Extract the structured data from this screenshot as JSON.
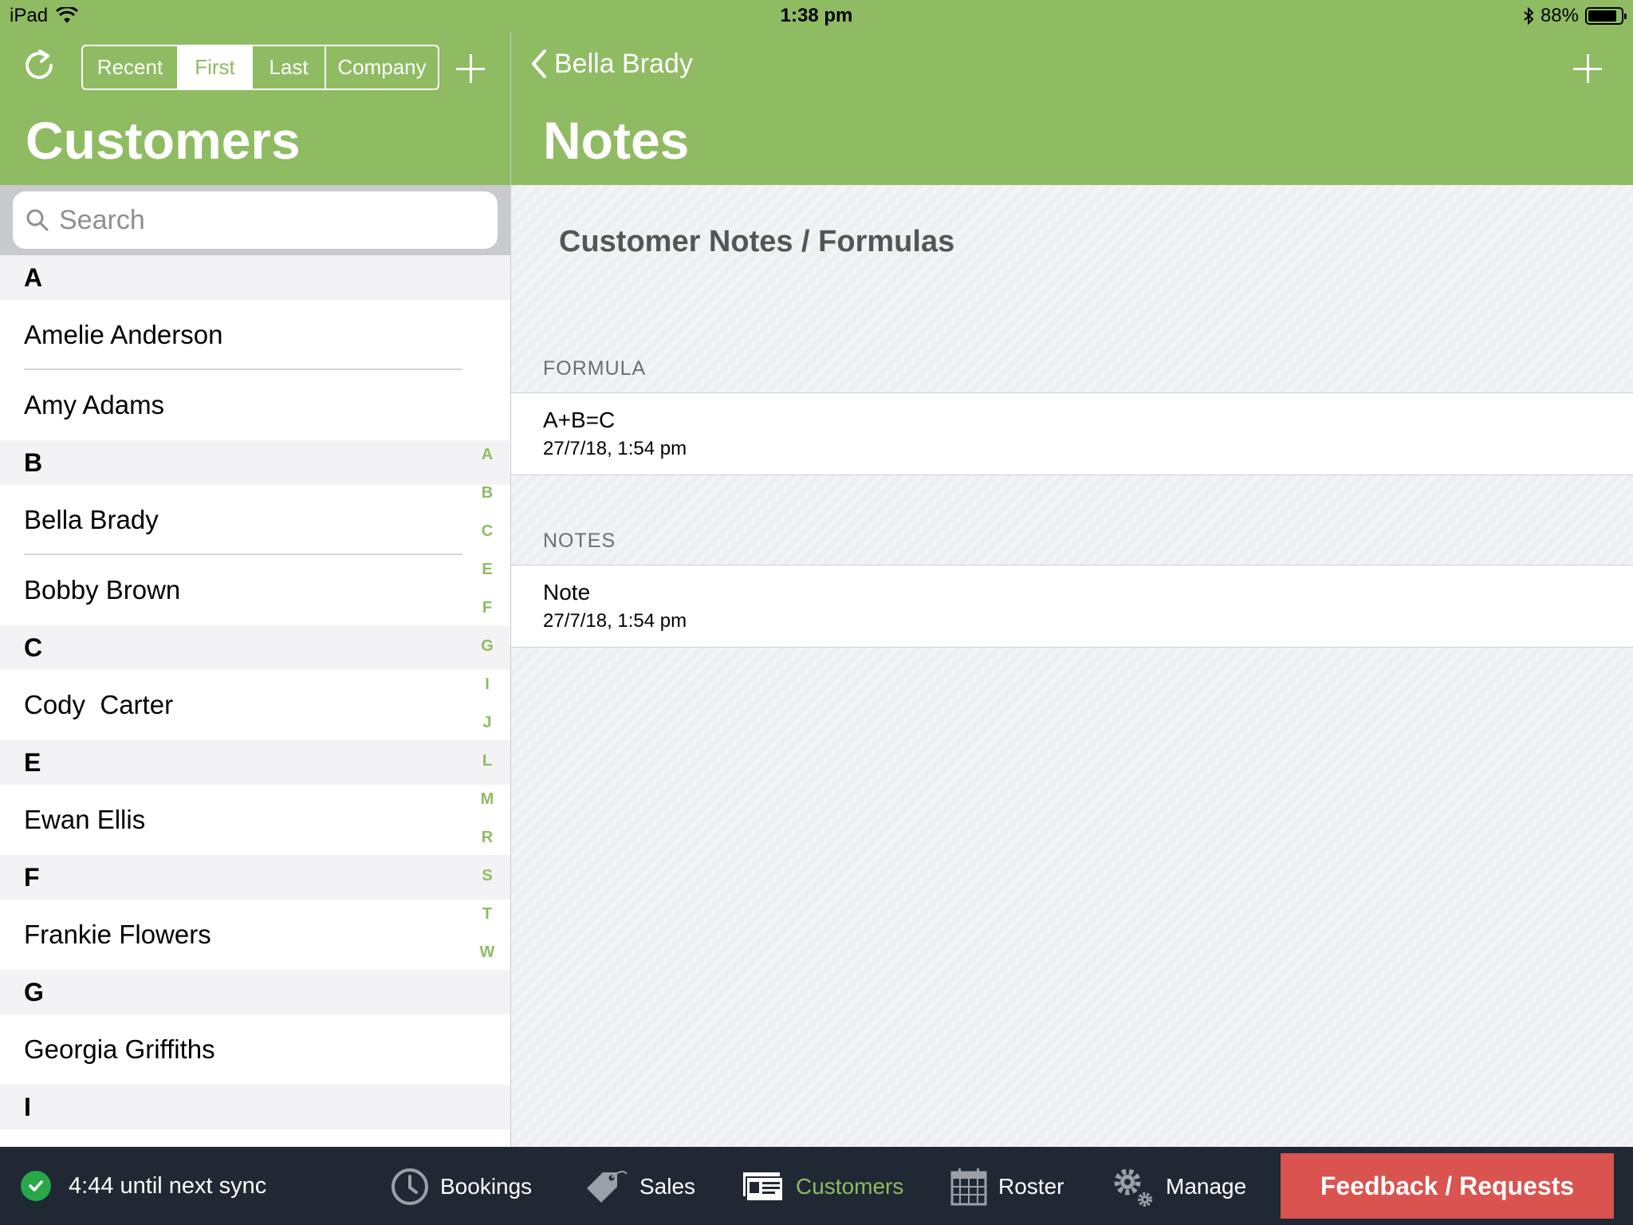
{
  "status_bar": {
    "device": "iPad",
    "time": "1:38 pm",
    "battery": "88%",
    "battery_level": 0.88
  },
  "left_header": {
    "sort_options": [
      {
        "label": "Recent",
        "active": false
      },
      {
        "label": "First",
        "active": true
      },
      {
        "label": "Last",
        "active": false
      },
      {
        "label": "Company",
        "active": false
      }
    ],
    "title": "Customers"
  },
  "search": {
    "placeholder": "Search"
  },
  "customer_list": [
    {
      "letter": "A",
      "names": [
        "Amelie Anderson",
        "Amy Adams"
      ]
    },
    {
      "letter": "B",
      "names": [
        "Bella Brady",
        "Bobby Brown"
      ]
    },
    {
      "letter": "C",
      "names": [
        "Cody  Carter"
      ]
    },
    {
      "letter": "E",
      "names": [
        "Ewan Ellis"
      ]
    },
    {
      "letter": "F",
      "names": [
        "Frankie Flowers"
      ]
    },
    {
      "letter": "G",
      "names": [
        "Georgia Griffiths"
      ]
    },
    {
      "letter": "I",
      "names": []
    }
  ],
  "index_letters": [
    "A",
    "B",
    "C",
    "E",
    "F",
    "G",
    "I",
    "J",
    "L",
    "M",
    "R",
    "S",
    "T",
    "W"
  ],
  "right_header": {
    "back_label": "Bella Brady",
    "title": "Notes"
  },
  "notes_page": {
    "heading": "Customer Notes / Formulas",
    "formula_label": "FORMULA",
    "formula": {
      "title": "A+B=C",
      "date": "27/7/18, 1:54 pm"
    },
    "notes_label": "NOTES",
    "note": {
      "title": "Note",
      "date": "27/7/18, 1:54 pm"
    }
  },
  "tabbar": {
    "sync_text": "4:44 until next sync",
    "tabs": {
      "bookings": "Bookings",
      "sales": "Sales",
      "customers": "Customers",
      "roster": "Roster",
      "manage": "Manage"
    },
    "feedback": "Feedback / Requests"
  },
  "colors": {
    "brand_green": "#8fbb63",
    "tabbar_bg": "#1f2833",
    "feedback_red": "#d9534f",
    "sync_green": "#29a84a"
  }
}
